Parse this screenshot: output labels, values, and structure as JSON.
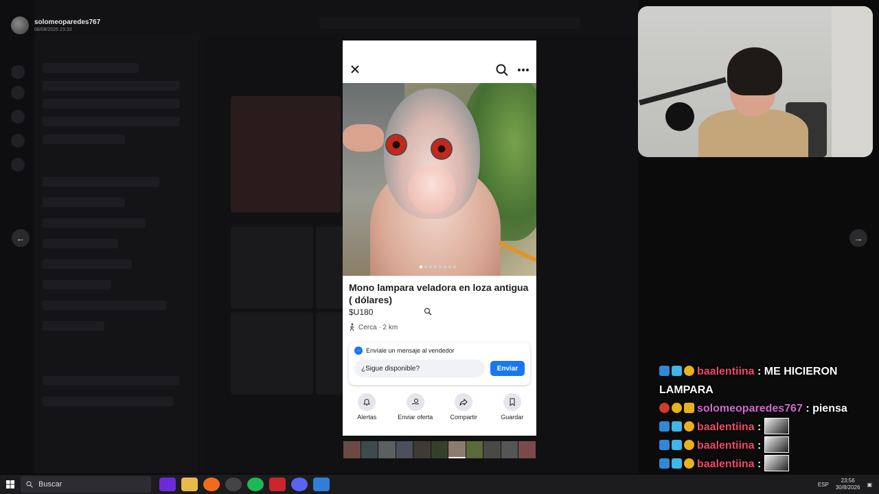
{
  "background": {
    "profile_name": "solomeoparedes767",
    "profile_date": "08/08/2026 23:33"
  },
  "listing": {
    "title": "Mono lampara veladora en loza antigua ( dólares)",
    "price": "$U180",
    "location": "Cerca · 2 km",
    "photo_count": 8,
    "photo_index": 1
  },
  "message": {
    "header": "Envíale un mensaje al vendedor",
    "input_value": "¿Sigue disponible?",
    "send_label": "Enviar"
  },
  "actions": [
    {
      "label": "Alertas",
      "icon": "bell-icon"
    },
    {
      "label": "Enviar oferta",
      "icon": "offer-icon"
    },
    {
      "label": "Compartir",
      "icon": "share-icon"
    },
    {
      "label": "Guardar",
      "icon": "bookmark-icon"
    }
  ],
  "chat": [
    {
      "user": "baalentiina",
      "text": ": ME HICIERON LAMPARA",
      "emote": false
    },
    {
      "user": "solomeoparedes767",
      "text": ": piensa",
      "emote": false
    },
    {
      "user": "baalentiina",
      "text": ":",
      "emote": true
    },
    {
      "user": "baalentiina",
      "text": ":",
      "emote": true
    },
    {
      "user": "baalentiina",
      "text": ":",
      "emote": true
    }
  ],
  "taskbar": {
    "search_label": "Buscar",
    "language": "ESP",
    "time": "23:56",
    "date": "30/8/2026"
  },
  "colors": {
    "facebook_blue": "#1877f2",
    "chat_user_red": "#f04a66",
    "chat_user_pink": "#d36ad6"
  }
}
